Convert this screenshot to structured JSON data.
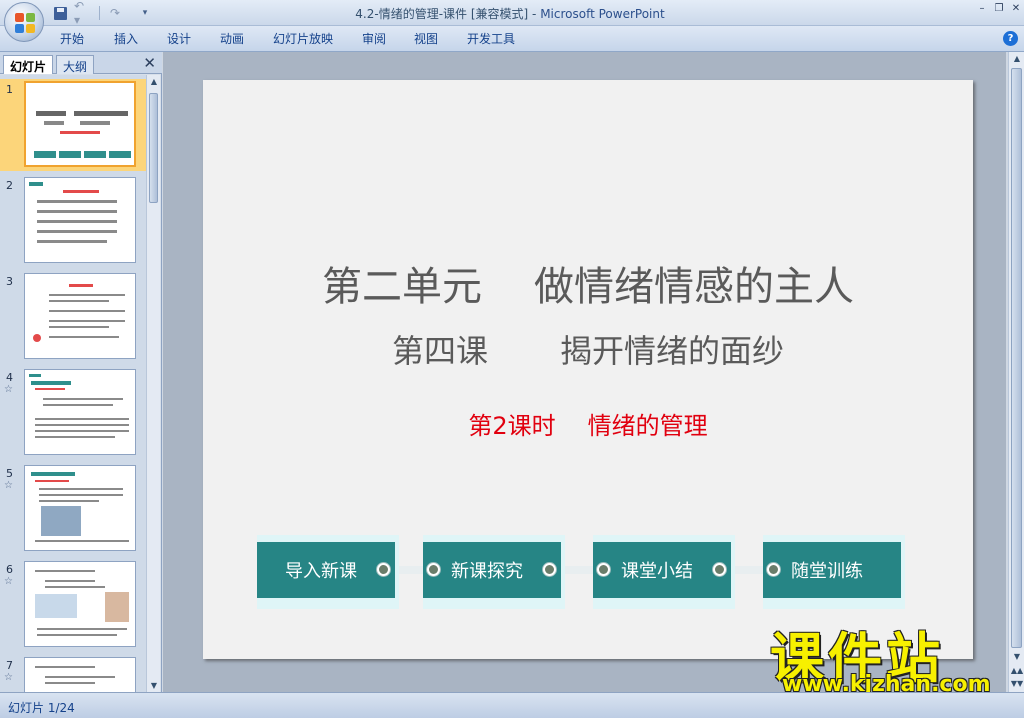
{
  "window": {
    "title_doc": "4.2-情绪的管理-课件 [兼容模式] - ",
    "title_app": "Microsoft PowerPoint",
    "controls": [
      "–",
      "❐",
      "✕"
    ]
  },
  "quick_access": {
    "undo": "↶ ▾",
    "redo": "↷",
    "more": "▾"
  },
  "ribbon": {
    "tabs": [
      "开始",
      "插入",
      "设计",
      "动画",
      "幻灯片放映",
      "审阅",
      "视图",
      "开发工具"
    ],
    "help": "?"
  },
  "left_pane": {
    "tabs": [
      "幻灯片",
      "大纲"
    ],
    "close": "✕",
    "slides": [
      {
        "num": "1",
        "star": ""
      },
      {
        "num": "2",
        "star": ""
      },
      {
        "num": "3",
        "star": ""
      },
      {
        "num": "4",
        "star": "☆"
      },
      {
        "num": "5",
        "star": "☆"
      },
      {
        "num": "6",
        "star": "☆"
      },
      {
        "num": "7",
        "star": "☆"
      }
    ]
  },
  "slide": {
    "title_left": "第二单元",
    "title_right": "做情绪情感的主人",
    "sub_left": "第四课",
    "sub_right": "揭开情绪的面纱",
    "red_left": "第2课时",
    "red_right": "情绪的管理",
    "nav": [
      "导入新课",
      "新课探究",
      "课堂小结",
      "随堂训练"
    ]
  },
  "watermark": {
    "big": "课件站",
    "url": "www.kjzhan.com"
  },
  "status": {
    "slide_indicator": "幻灯片 1/24"
  },
  "colors": {
    "teal": "#268585",
    "red": "#e1000f",
    "selection": "#fcd57a"
  }
}
